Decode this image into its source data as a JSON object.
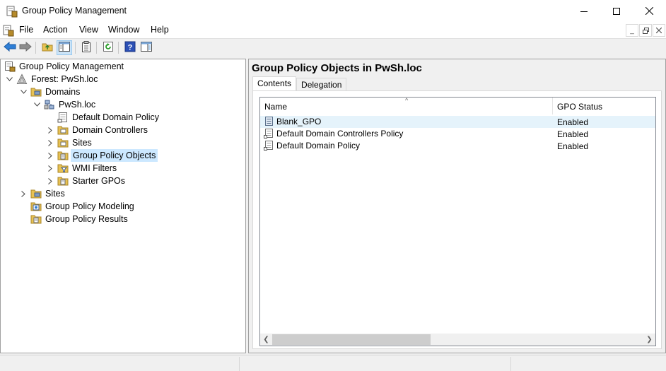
{
  "window": {
    "title": "Group Policy Management",
    "controls": [
      "minimize",
      "maximize",
      "close"
    ]
  },
  "menu": {
    "items": [
      "File",
      "Action",
      "View",
      "Window",
      "Help"
    ]
  },
  "toolbar": {
    "buttons": [
      "back-arrow-icon",
      "forward-arrow-icon",
      "up-folder-icon",
      "show-hide-tree-icon",
      "properties-icon",
      "refresh-icon",
      "help-icon",
      "show-action-pane-icon"
    ]
  },
  "tree": {
    "root": "Group Policy Management",
    "forest": "Forest: PwSh.loc",
    "domains": "Domains",
    "domain": "PwSh.loc",
    "default_domain_policy": "Default Domain Policy",
    "domain_controllers": "Domain Controllers",
    "sites_child": "Sites",
    "gpo_container": "Group Policy Objects",
    "wmi_filters": "WMI Filters",
    "starter_gpos": "Starter GPOs",
    "sites": "Sites",
    "modeling": "Group Policy Modeling",
    "results": "Group Policy Results"
  },
  "content": {
    "title": "Group Policy Objects in PwSh.loc",
    "tabs": [
      "Contents",
      "Delegation"
    ],
    "active_tab": "Contents",
    "columns": [
      "Name",
      "GPO Status"
    ],
    "rows": [
      {
        "name": "Blank_GPO",
        "status": "Enabled"
      },
      {
        "name": "Default Domain Controllers Policy",
        "status": "Enabled"
      },
      {
        "name": "Default Domain Policy",
        "status": "Enabled"
      }
    ]
  },
  "colors": {
    "selection": "#cce8ff",
    "hover_row": "#e5f3fb",
    "chrome": "#f0f0f0"
  }
}
